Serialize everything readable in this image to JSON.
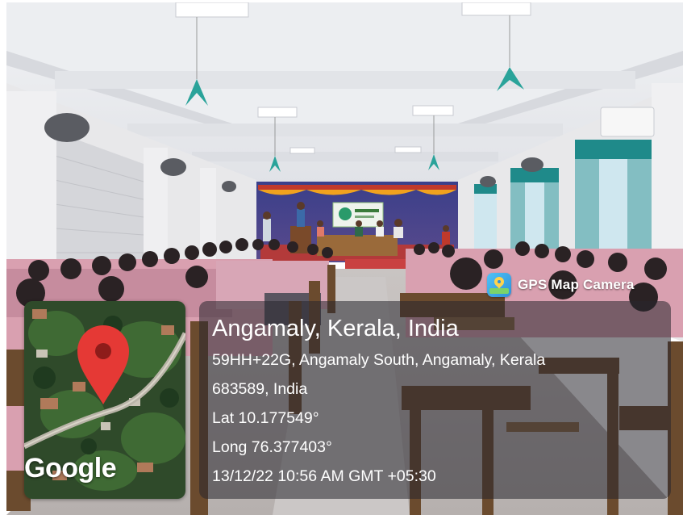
{
  "overlay": {
    "app_badge": "GPS Map Camera",
    "app_icon": "gps-map-camera-icon",
    "map_logo": "Google",
    "map_pin_icon": "map-pin-icon",
    "location_title": "Angamaly, Kerala, India",
    "address_line_1": "59HH+22G, Angamaly South, Angamaly, Kerala",
    "address_line_2": "683589, India",
    "latitude": "Lat 10.177549°",
    "longitude": "Long 76.377403°",
    "timestamp": "13/12/22 10:56 AM GMT +05:30"
  },
  "colors": {
    "pin_red": "#e53935",
    "panel_bg": "#28262d",
    "curtain_teal": "#1f8a8a",
    "uniform_pink": "#d9a0b0"
  }
}
